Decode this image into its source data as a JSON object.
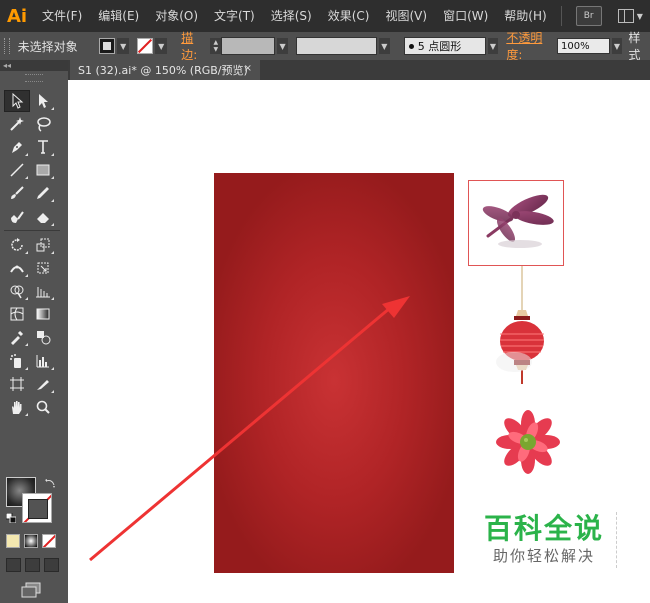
{
  "app": {
    "logo": "Ai",
    "bridge_label": "Br"
  },
  "menu": {
    "items": [
      "文件(F)",
      "编辑(E)",
      "对象(O)",
      "文字(T)",
      "选择(S)",
      "效果(C)",
      "视图(V)",
      "窗口(W)",
      "帮助(H)"
    ]
  },
  "control_bar": {
    "selection_status": "未选择对象",
    "stroke_label": "描边:",
    "brush_label": "5 点圆形",
    "opacity_label": "不透明度:",
    "opacity_value": "100%",
    "style_label": "样式"
  },
  "document_tab": {
    "title": "S1 (32).ai* @ 150% (RGB/预览)",
    "close": "×"
  },
  "toolbar": {
    "collapse": "◂◂"
  },
  "watermark": {
    "main": "百科全说",
    "sub": "助你轻松解决"
  },
  "colors": {
    "accent_orange": "#ff9a3c",
    "artboard_red": "#b02426",
    "arrow_red": "#ee3333",
    "watermark_green": "#2bb34a"
  }
}
